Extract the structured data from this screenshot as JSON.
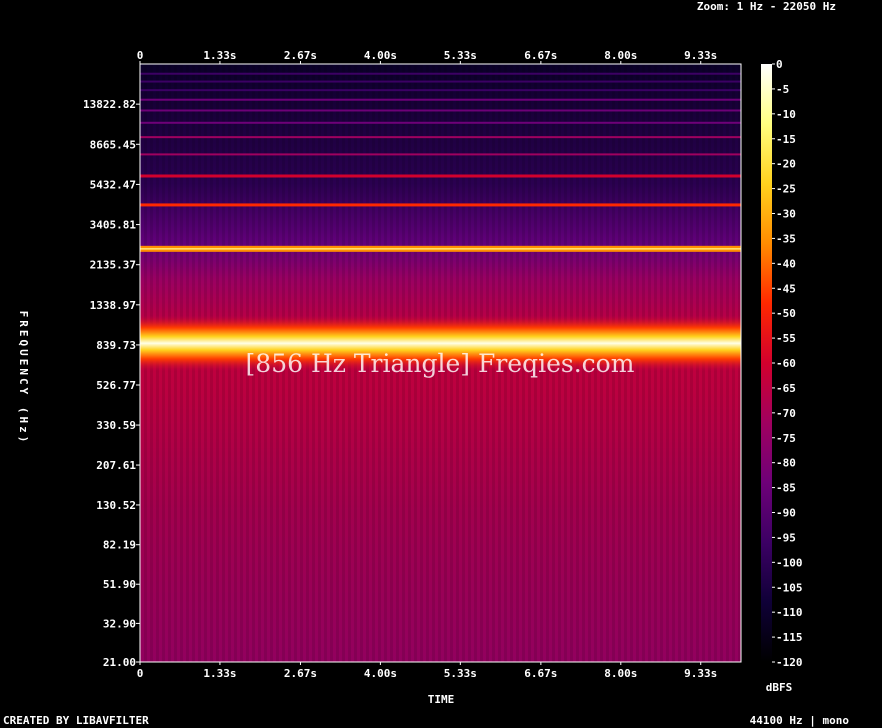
{
  "header": {
    "zoom": "Zoom: 1 Hz - 22050 Hz"
  },
  "footer": {
    "left": "CREATED BY LIBAVFILTER",
    "right": "44100 Hz | mono"
  },
  "watermark": "[856 Hz Triangle] Freqies.com",
  "chart_data": {
    "type": "heatmap",
    "title": "",
    "xlabel": "TIME",
    "ylabel": "FREQUENCY (Hz)",
    "x_tick_labels": [
      "0",
      "1.33s",
      "2.67s",
      "4.00s",
      "5.33s",
      "6.67s",
      "8.00s",
      "9.33s"
    ],
    "x_ticks_seconds": [
      0,
      1.33,
      2.67,
      4.0,
      5.33,
      6.67,
      8.0,
      9.33
    ],
    "xlim": [
      0,
      10
    ],
    "y_tick_labels": [
      "13822.82",
      "8665.45",
      "5432.47",
      "3405.81",
      "2135.37",
      "1338.97",
      "839.73",
      "526.77",
      "330.59",
      "207.61",
      "130.52",
      "82.19",
      "51.90",
      "32.90",
      "21.00"
    ],
    "y_ticks_hz": [
      13822.82,
      8665.45,
      5432.47,
      3405.81,
      2135.37,
      1338.97,
      839.73,
      526.77,
      330.59,
      207.61,
      130.52,
      82.19,
      51.9,
      32.9,
      21.0
    ],
    "ylim_hz": [
      21,
      22050
    ],
    "y_scale": "log",
    "colorbar": {
      "label": "dBFS",
      "tick_labels": [
        "0",
        "-5",
        "-10",
        "-15",
        "-20",
        "-25",
        "-30",
        "-35",
        "-40",
        "-45",
        "-50",
        "-55",
        "-60",
        "-65",
        "-70",
        "-75",
        "-80",
        "-85",
        "-90",
        "-95",
        "-100",
        "-105",
        "-110",
        "-115",
        "-120"
      ],
      "range_dbfs": [
        -120,
        0
      ],
      "stops": [
        "#ffffff",
        "#ffff80",
        "#ffd21e",
        "#ff8c00",
        "#ff2800",
        "#d2002d",
        "#a0005f",
        "#6e0078",
        "#3c0064",
        "#0f0037",
        "#000000"
      ]
    },
    "harmonics": [
      {
        "hz": 856,
        "dbfs": -3
      },
      {
        "hz": 2568,
        "dbfs": -40
      },
      {
        "hz": 4280,
        "dbfs": -52
      },
      {
        "hz": 5992,
        "dbfs": -62
      },
      {
        "hz": 7704,
        "dbfs": -70
      },
      {
        "hz": 9416,
        "dbfs": -74
      },
      {
        "hz": 11128,
        "dbfs": -80
      },
      {
        "hz": 12840,
        "dbfs": -85
      },
      {
        "hz": 14552,
        "dbfs": -88
      },
      {
        "hz": 16264,
        "dbfs": -91
      },
      {
        "hz": 17976,
        "dbfs": -94
      },
      {
        "hz": 19688,
        "dbfs": -97
      }
    ]
  }
}
